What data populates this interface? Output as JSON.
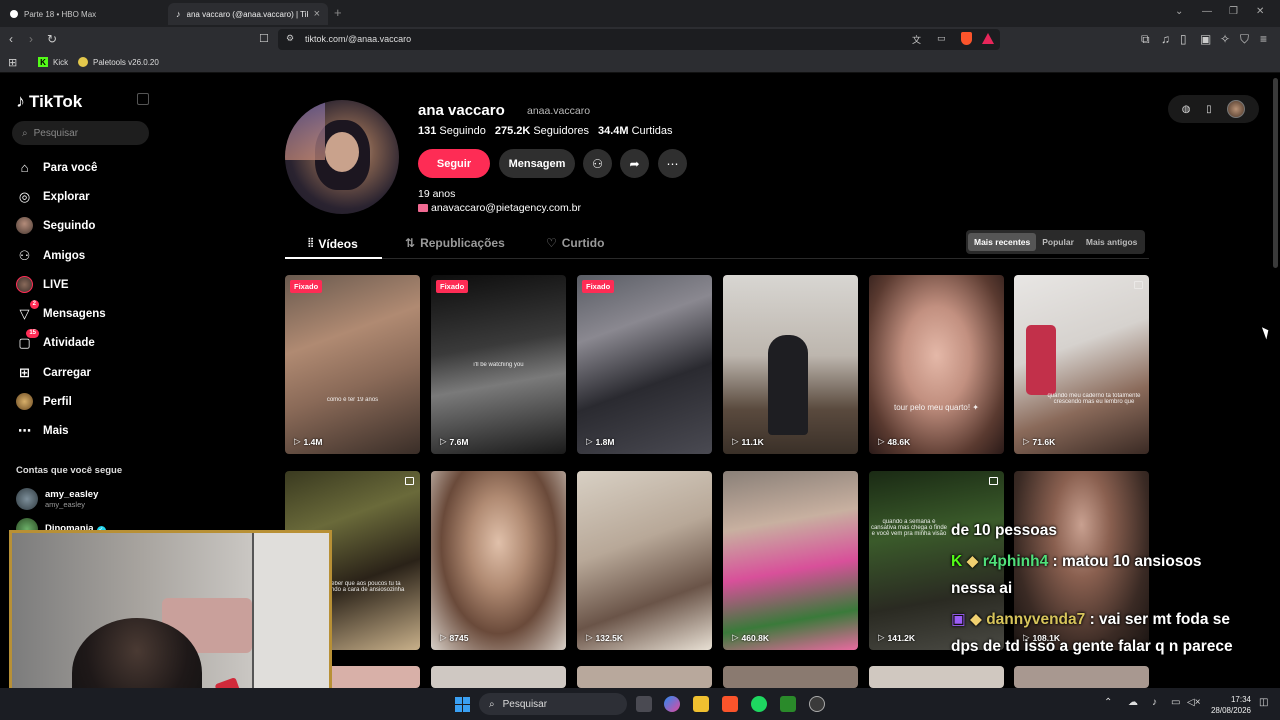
{
  "browser": {
    "tabs": [
      {
        "title": "Parte 18 • HBO Max"
      },
      {
        "title": "ana vaccaro (@anaa.vaccaro) | TikTok"
      }
    ],
    "url": "tiktok.com/@anaa.vaccaro",
    "bookmarks": [
      {
        "label": "Kick"
      },
      {
        "label": "Paletools v26.0.20"
      }
    ]
  },
  "sidebar": {
    "logo": "TikTok",
    "search_placeholder": "Pesquisar",
    "items": [
      {
        "label": "Para você",
        "icon": "home-icon"
      },
      {
        "label": "Explorar",
        "icon": "compass-icon"
      },
      {
        "label": "Seguindo",
        "icon": "following-avatar"
      },
      {
        "label": "Amigos",
        "icon": "friends-icon"
      },
      {
        "label": "LIVE",
        "icon": "live-avatar"
      },
      {
        "label": "Mensagens",
        "icon": "messages-icon",
        "badge": "2"
      },
      {
        "label": "Atividade",
        "icon": "activity-icon",
        "badge": "15"
      },
      {
        "label": "Carregar",
        "icon": "upload-icon"
      },
      {
        "label": "Perfil",
        "icon": "profile-avatar"
      },
      {
        "label": "Mais",
        "icon": "more-icon"
      }
    ],
    "following_title": "Contas que você segue",
    "following": [
      {
        "name": "amy_easley",
        "sub": "amy_easley"
      },
      {
        "name": "Dinomania",
        "sub": "",
        "verified": true
      }
    ]
  },
  "profile": {
    "name": "ana vaccaro",
    "handle": "anaa.vaccaro",
    "following_count": "131",
    "following_label": "Seguindo",
    "followers_count": "275.2K",
    "followers_label": "Seguidores",
    "likes_count": "34.4M",
    "likes_label": "Curtidas",
    "follow_btn": "Seguir",
    "message_btn": "Mensagem",
    "bio_age": "19 anos",
    "bio_email": "anavaccaro@pietagency.com.br"
  },
  "profile_tabs": [
    {
      "label": "Vídeos"
    },
    {
      "label": "Republicações"
    },
    {
      "label": "Curtido"
    }
  ],
  "sort": {
    "options": [
      "Mais recentes",
      "Popular",
      "Mais antigos"
    ],
    "selected": "Mais recentes"
  },
  "videos": [
    {
      "views": "1.4M",
      "pinned": "Fixado",
      "caption": "como é ter 19 anos"
    },
    {
      "views": "7.6M",
      "pinned": "Fixado",
      "caption": "i'll be watching you"
    },
    {
      "views": "1.8M",
      "pinned": "Fixado",
      "caption": ""
    },
    {
      "views": "11.1K",
      "pinned": "",
      "caption": ""
    },
    {
      "views": "48.6K",
      "pinned": "",
      "caption": "tour pelo meu quarto! ✦"
    },
    {
      "views": "71.6K",
      "pinned": "",
      "caption": "quando meu caderno ta totalmente crescendo mas eu lembro que"
    },
    {
      "views": "",
      "pinned": "",
      "caption": "perceber que aos poucos tu ta perdendo a cara de ansiosozinha"
    },
    {
      "views": "8745",
      "pinned": "",
      "caption": ""
    },
    {
      "views": "132.5K",
      "pinned": "",
      "caption": ""
    },
    {
      "views": "460.8K",
      "pinned": "",
      "caption": ""
    },
    {
      "views": "141.2K",
      "pinned": "",
      "caption": "quando a semana é cansativa mas chega o finde e você vem pra minha visão"
    },
    {
      "views": "108.1K",
      "pinned": "",
      "caption": ""
    }
  ],
  "chat": [
    {
      "user": "",
      "text": "de 10 pessoas"
    },
    {
      "user": "r4phinh4",
      "text": ": matou 10 ansiosos"
    },
    {
      "user": "",
      "text": "nessa ai"
    },
    {
      "user": "dannyvenda7",
      "text": ": vai ser mt foda se"
    },
    {
      "user": "",
      "text": "dps de td isso a gente falar q n parece"
    }
  ],
  "taskbar": {
    "search": "Pesquisar",
    "time": "17:34",
    "date": "28/08/2026"
  },
  "colors": {
    "accent": "#fe2c55",
    "chat_user_green": "#50e07a",
    "chat_user_yellow": "#d7c45b",
    "webcam_border": "#b89035"
  }
}
